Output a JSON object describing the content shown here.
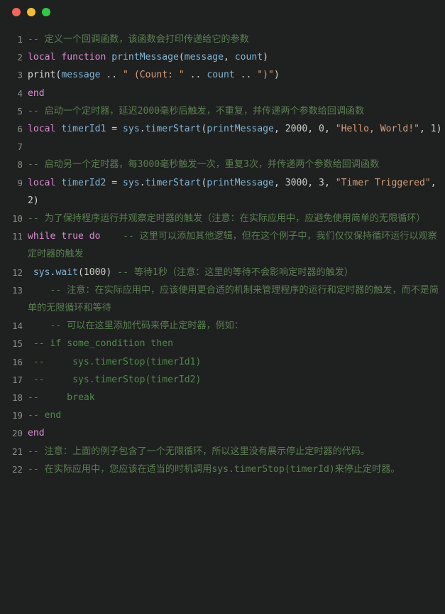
{
  "window": {
    "controls": [
      {
        "name": "close",
        "color": "#f1675c"
      },
      {
        "name": "minimize",
        "color": "#f3bc38"
      },
      {
        "name": "maximize",
        "color": "#33c748"
      }
    ]
  },
  "editor": {
    "language": "lua",
    "theme": {
      "background": "#1f2020",
      "foreground": "#d6d9d6",
      "gutter": "#8b908b",
      "comment": "#5b7f52",
      "comment_code": "#4f8a4a",
      "keyword": "#d98bd0",
      "identifier": "#82b5d6",
      "string": "#d8a07a",
      "number": "#c9cec9"
    },
    "lines": [
      {
        "number": "1",
        "tokens": [
          {
            "t": "-- ",
            "c": "comment"
          },
          {
            "t": "定义一个回调函数，该函数会打印传递给它的参数",
            "c": "comment"
          }
        ]
      },
      {
        "number": "2",
        "tokens": [
          {
            "t": "local",
            "c": "kw"
          },
          {
            "t": " ",
            "c": "plain"
          },
          {
            "t": "function",
            "c": "kw"
          },
          {
            "t": " ",
            "c": "plain"
          },
          {
            "t": "printMessage",
            "c": "fn"
          },
          {
            "t": "(",
            "c": "plain"
          },
          {
            "t": "message",
            "c": "id"
          },
          {
            "t": ", ",
            "c": "plain"
          },
          {
            "t": "count",
            "c": "id"
          },
          {
            "t": ")",
            "c": "plain"
          }
        ]
      },
      {
        "number": "3",
        "tokens": [
          {
            "t": "print",
            "c": "plain"
          },
          {
            "t": "(",
            "c": "plain"
          },
          {
            "t": "message",
            "c": "id"
          },
          {
            "t": " .. ",
            "c": "op"
          },
          {
            "t": "\" (Count: \"",
            "c": "str"
          },
          {
            "t": " .. ",
            "c": "op"
          },
          {
            "t": "count",
            "c": "id"
          },
          {
            "t": " .. ",
            "c": "op"
          },
          {
            "t": "\")\"",
            "c": "str"
          },
          {
            "t": ")",
            "c": "plain"
          }
        ]
      },
      {
        "number": "4",
        "tokens": [
          {
            "t": "end",
            "c": "kw"
          }
        ]
      },
      {
        "number": "5",
        "tokens": [
          {
            "t": "-- ",
            "c": "comment"
          },
          {
            "t": "启动一个定时器，延迟2000毫秒后触发，不重复，并传递两个参数给回调函数",
            "c": "comment"
          }
        ]
      },
      {
        "number": "6",
        "tokens": [
          {
            "t": "local",
            "c": "kw"
          },
          {
            "t": " ",
            "c": "plain"
          },
          {
            "t": "timerId1",
            "c": "id"
          },
          {
            "t": " = ",
            "c": "op"
          },
          {
            "t": "sys",
            "c": "id"
          },
          {
            "t": ".",
            "c": "plain"
          },
          {
            "t": "timerStart",
            "c": "fn"
          },
          {
            "t": "(",
            "c": "plain"
          },
          {
            "t": "printMessage",
            "c": "id"
          },
          {
            "t": ", ",
            "c": "plain"
          },
          {
            "t": "2000",
            "c": "num"
          },
          {
            "t": ", ",
            "c": "plain"
          },
          {
            "t": "0",
            "c": "num"
          },
          {
            "t": ", ",
            "c": "plain"
          },
          {
            "t": "\"Hello, World!\"",
            "c": "str"
          },
          {
            "t": ", ",
            "c": "plain"
          },
          {
            "t": "1",
            "c": "num"
          },
          {
            "t": ")",
            "c": "plain"
          }
        ]
      },
      {
        "number": "7",
        "tokens": []
      },
      {
        "number": "8",
        "tokens": [
          {
            "t": "-- ",
            "c": "comment"
          },
          {
            "t": "启动另一个定时器，每3000毫秒触发一次，重复3次，并传递两个参数给回调函数",
            "c": "comment"
          }
        ]
      },
      {
        "number": "9",
        "tokens": [
          {
            "t": "local",
            "c": "kw"
          },
          {
            "t": " ",
            "c": "plain"
          },
          {
            "t": "timerId2",
            "c": "id"
          },
          {
            "t": " = ",
            "c": "op"
          },
          {
            "t": "sys",
            "c": "id"
          },
          {
            "t": ".",
            "c": "plain"
          },
          {
            "t": "timerStart",
            "c": "fn"
          },
          {
            "t": "(",
            "c": "plain"
          },
          {
            "t": "printMessage",
            "c": "id"
          },
          {
            "t": ", ",
            "c": "plain"
          },
          {
            "t": "3000",
            "c": "num"
          },
          {
            "t": ", ",
            "c": "plain"
          },
          {
            "t": "3",
            "c": "num"
          },
          {
            "t": ", ",
            "c": "plain"
          },
          {
            "t": "\"Timer Triggered\"",
            "c": "str"
          },
          {
            "t": ", ",
            "c": "plain"
          },
          {
            "t": "2",
            "c": "num"
          },
          {
            "t": ")",
            "c": "plain"
          }
        ]
      },
      {
        "number": "10",
        "tokens": [
          {
            "t": "-- ",
            "c": "comment"
          },
          {
            "t": "为了保持程序运行并观察定时器的触发（注意：在实际应用中，应避免使用简单的无限循环）",
            "c": "comment"
          }
        ]
      },
      {
        "number": "11",
        "tokens": [
          {
            "t": "while",
            "c": "kw"
          },
          {
            "t": " ",
            "c": "plain"
          },
          {
            "t": "true",
            "c": "kw"
          },
          {
            "t": " ",
            "c": "plain"
          },
          {
            "t": "do",
            "c": "kw"
          },
          {
            "t": "    ",
            "c": "plain"
          },
          {
            "t": "-- ",
            "c": "comment"
          },
          {
            "t": "这里可以添加其他逻辑，但在这个例子中，我们仅仅保持循环运行以观察定时器的触发",
            "c": "comment"
          }
        ]
      },
      {
        "number": "12",
        "tokens": [
          {
            "t": " ",
            "c": "plain"
          },
          {
            "t": "sys",
            "c": "id"
          },
          {
            "t": ".",
            "c": "plain"
          },
          {
            "t": "wait",
            "c": "fn"
          },
          {
            "t": "(",
            "c": "plain"
          },
          {
            "t": "1000",
            "c": "num"
          },
          {
            "t": ")",
            "c": "plain"
          },
          {
            "t": " ",
            "c": "plain"
          },
          {
            "t": "-- ",
            "c": "comment"
          },
          {
            "t": "等待1秒（注意：这里的等待不会影响定时器的触发）",
            "c": "comment"
          }
        ]
      },
      {
        "number": "13",
        "tokens": [
          {
            "t": "    ",
            "c": "plain"
          },
          {
            "t": "-- ",
            "c": "comment"
          },
          {
            "t": "注意：在实际应用中，应该使用更合适的机制来管理程序的运行和定时器的触发，而不是简单的无限循环和等待",
            "c": "comment"
          }
        ]
      },
      {
        "number": "14",
        "tokens": [
          {
            "t": "    ",
            "c": "plain"
          },
          {
            "t": "-- ",
            "c": "comment"
          },
          {
            "t": "可以在这里添加代码来停止定时器，例如：",
            "c": "comment"
          }
        ]
      },
      {
        "number": "15",
        "tokens": [
          {
            "t": " -- if some_condition then",
            "c": "comment-b"
          }
        ]
      },
      {
        "number": "16",
        "tokens": [
          {
            "t": " --     sys.timerStop(timerId1)",
            "c": "comment-b"
          }
        ]
      },
      {
        "number": "17",
        "tokens": [
          {
            "t": " --     sys.timerStop(timerId2)",
            "c": "comment-b"
          }
        ]
      },
      {
        "number": "18",
        "tokens": [
          {
            "t": "--     break",
            "c": "comment-b"
          }
        ]
      },
      {
        "number": "19",
        "tokens": [
          {
            "t": "-- end",
            "c": "comment-b"
          }
        ]
      },
      {
        "number": "20",
        "tokens": [
          {
            "t": "end",
            "c": "kw"
          }
        ]
      },
      {
        "number": "21",
        "tokens": [
          {
            "t": "-- ",
            "c": "comment"
          },
          {
            "t": "注意：上面的例子包含了一个无限循环，所以这里没有展示停止定时器的代码。",
            "c": "comment"
          }
        ]
      },
      {
        "number": "22",
        "tokens": [
          {
            "t": "-- ",
            "c": "comment"
          },
          {
            "t": "在实际应用中，您应该在适当的时机调用sys.timerStop(timerId)来停止定时器。",
            "c": "comment"
          }
        ]
      }
    ]
  }
}
